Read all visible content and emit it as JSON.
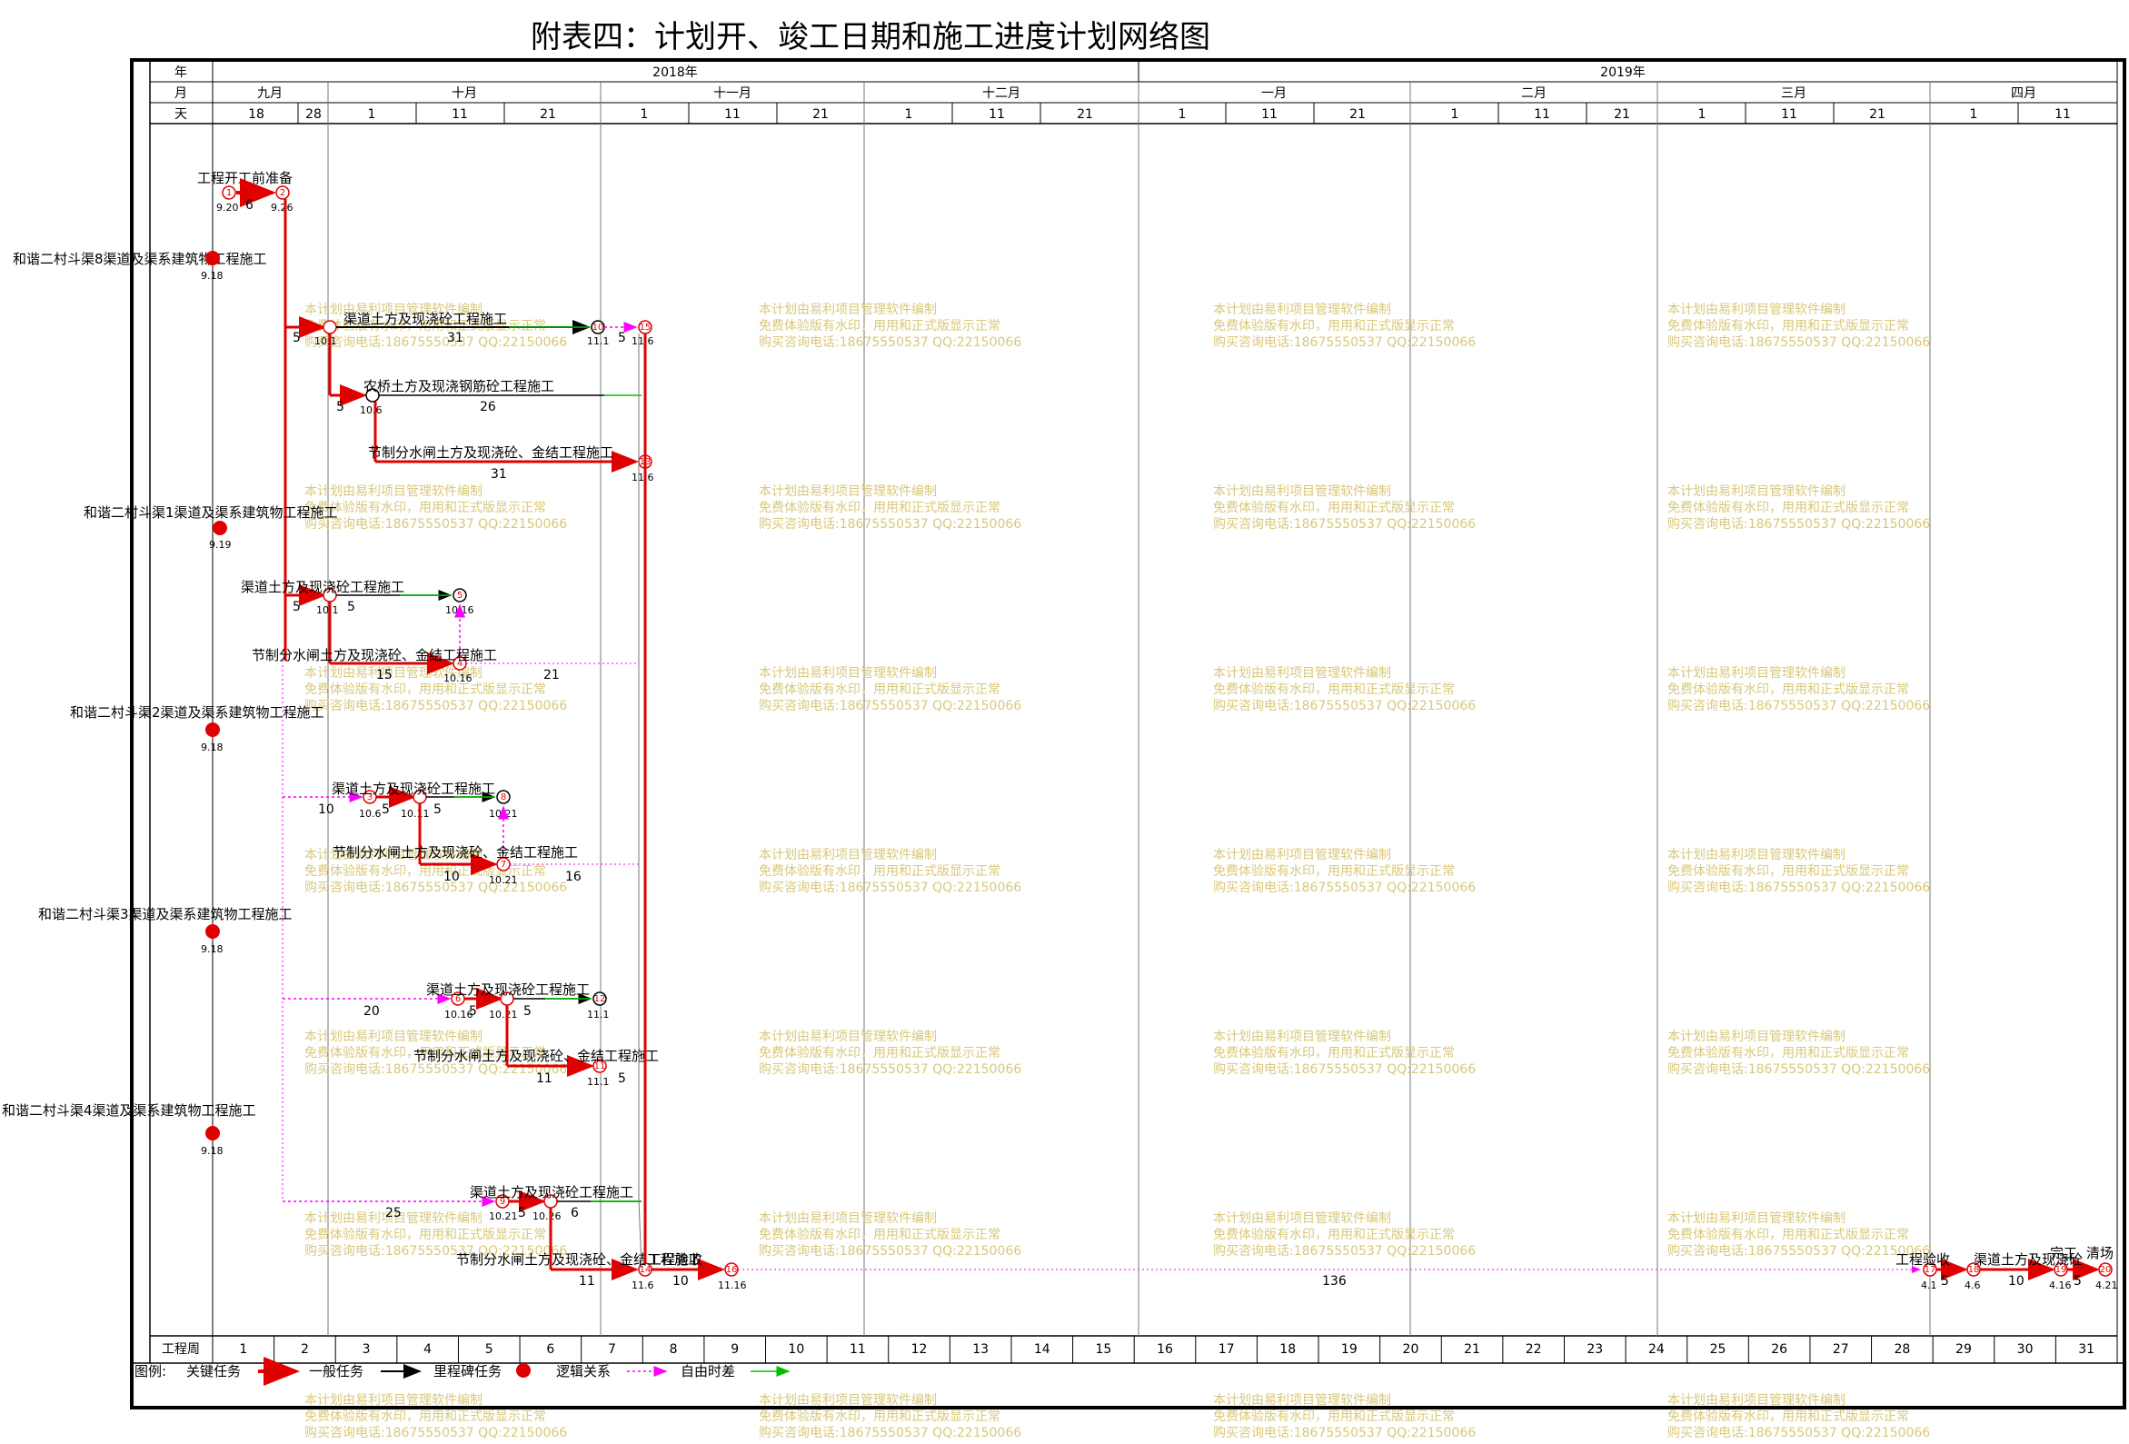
{
  "title": "附表四：计划开、竣工日期和施工进度计划网络图",
  "header": {
    "row_labels": [
      "年",
      "月",
      "天"
    ],
    "years": [
      "2018年",
      "2019年"
    ],
    "months": [
      "九月",
      "十月",
      "十一月",
      "十二月",
      "一月",
      "二月",
      "三月",
      "四月"
    ],
    "days": [
      "18",
      "28",
      "1",
      "11",
      "21",
      "1",
      "11",
      "21",
      "1",
      "11",
      "21",
      "1",
      "11",
      "21",
      "1",
      "11",
      "21",
      "1",
      "11",
      "21",
      "1",
      "11"
    ]
  },
  "footer": {
    "label": "工程周",
    "weeks": [
      "1",
      "2",
      "3",
      "4",
      "5",
      "6",
      "7",
      "8",
      "9",
      "10",
      "11",
      "12",
      "13",
      "14",
      "15",
      "16",
      "17",
      "18",
      "19",
      "20",
      "21",
      "22",
      "23",
      "24",
      "25",
      "26",
      "27",
      "28",
      "29",
      "30",
      "31"
    ]
  },
  "legend": {
    "label": "图例:",
    "items": [
      "关键任务",
      "一般任务",
      "里程碑任务",
      "逻辑关系",
      "自由时差"
    ]
  },
  "colors": {
    "critical": "#e00000",
    "normal": "#000000",
    "logic": "#ff00ff",
    "float": "#00c000",
    "watermark": "#d8c87a"
  },
  "watermark": [
    "本计划由易利项目管理软件编制",
    "免费体验版有水印，用用和正式版显示正常",
    "购买咨询电话:18675550537 QQ:22150066"
  ],
  "tasks": [
    {
      "label": "工程开工前准备",
      "dur": "6",
      "start": "9.20",
      "end": "9.26",
      "n1": "1",
      "n2": "2"
    },
    {
      "label": "和谐二村斗渠8渠道及渠系建筑物工程施工",
      "date": "9.18"
    },
    {
      "label": "渠道土方及现浇砼工程施工",
      "dur": "31",
      "lead": "5",
      "start": "10.1",
      "end": "11.1",
      "after": "5",
      "n": "10",
      "n2": "15",
      "d2": "11.6"
    },
    {
      "label": "农桥土方及现浇钢筋砼工程施工",
      "dur": "26",
      "lead": "5",
      "start": "10.6"
    },
    {
      "label": "节制分水闸土方及现浇砼、金结工程施工",
      "dur": "31",
      "end": "11.6",
      "n": "13"
    },
    {
      "label": "和谐二村斗渠1渠道及渠系建筑物工程施工",
      "date": "9.19"
    },
    {
      "label": "渠道土方及现浇砼工程施工",
      "lead": "5",
      "start": "10.1",
      "dur": "5",
      "end": "10.16",
      "n": "5"
    },
    {
      "label": "节制分水闸土方及现浇砼、金结工程施工",
      "dur": "15",
      "end": "10.16",
      "after": "21",
      "n": "4"
    },
    {
      "label": "和谐二村斗渠2渠道及渠系建筑物工程施工",
      "date": "9.18"
    },
    {
      "label": "渠道土方及现浇砼工程施工",
      "lead": "10",
      "start": "10.6",
      "dur": "5",
      "mid": "10.11",
      "dur2": "5",
      "end": "10.21",
      "n1": "3",
      "n2": "8"
    },
    {
      "label": "节制分水闸土方及现浇砼、金结工程施工",
      "dur": "10",
      "end": "10.21",
      "after": "16",
      "n": "7"
    },
    {
      "label": "和谐二村斗渠3渠道及渠系建筑物工程施工",
      "date": "9.18"
    },
    {
      "label": "渠道土方及现浇砼工程施工",
      "lead": "20",
      "start": "10.16",
      "dur": "5",
      "mid": "10.21",
      "dur2": "5",
      "end": "11.1",
      "n1": "6",
      "n2": "12"
    },
    {
      "label": "节制分水闸土方及现浇砼、金结工程施工",
      "dur": "11",
      "end": "11.1",
      "after": "5",
      "n": "11"
    },
    {
      "label": "和谐二村斗渠4渠道及渠系建筑物工程施工",
      "date": "9.18"
    },
    {
      "label": "渠道土方及现浇砼工程施工",
      "lead": "25",
      "start": "10.21",
      "dur": "5",
      "end": "10.26",
      "after": "6",
      "n1": "9"
    },
    {
      "label": "节制分水闸土方及现浇砼、金结工程施工",
      "dur": "11",
      "end": "11.6",
      "n": "14"
    },
    {
      "label": "工程验收",
      "dur": "10",
      "end": "11.16",
      "after": "136",
      "n": "16"
    },
    {
      "label": "工程验收",
      "start": "4.1",
      "dur": "5",
      "n": "17"
    },
    {
      "label": "渠道土方及现浇砼",
      "end": "4.6",
      "dur": "10",
      "n": "18"
    },
    {
      "label": "完工",
      "end": "4.16",
      "dur": "5",
      "n": "19"
    },
    {
      "label": "清场",
      "end": "4.21",
      "n": "20"
    }
  ]
}
